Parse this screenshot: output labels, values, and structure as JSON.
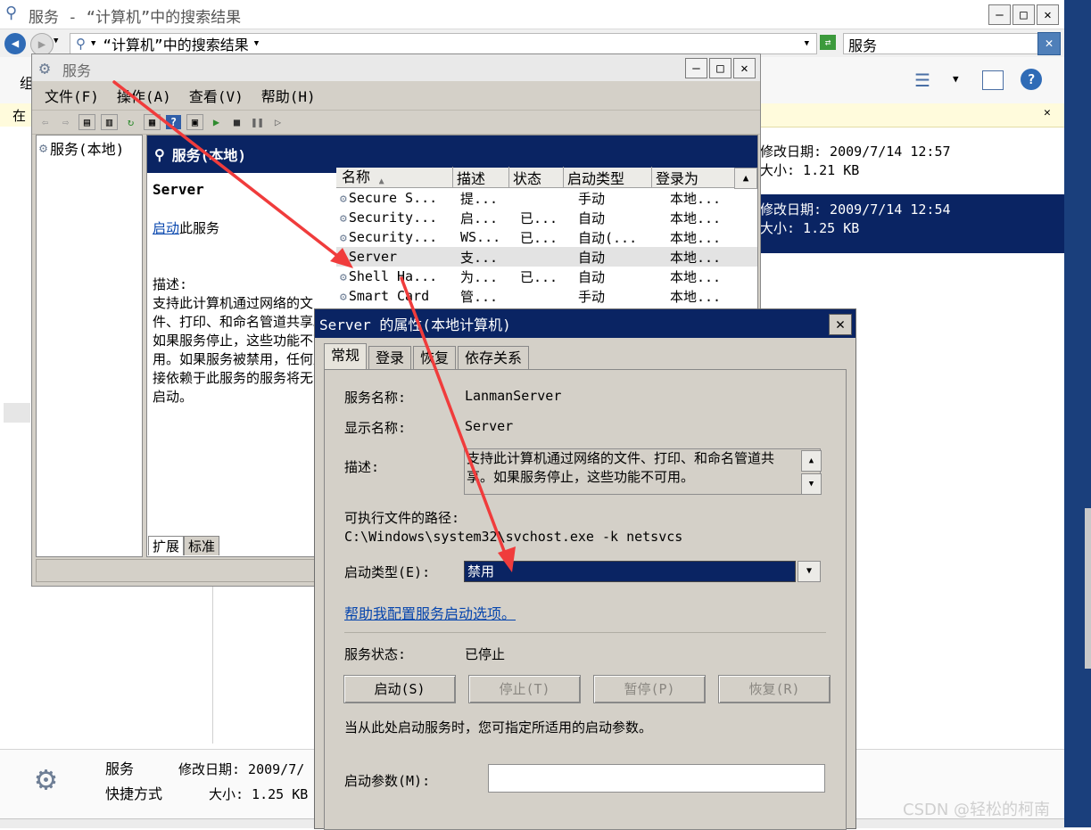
{
  "explorer": {
    "title": "服务 - “计算机”中的搜索结果",
    "address": "“计算机”中的搜索结果",
    "search_value": "服务",
    "toolbar_partial": "组",
    "infobar_partial": "在",
    "file1": {
      "modified": "修改日期: 2009/7/14 12:57",
      "size": "大小: 1.21 KB"
    },
    "file2": {
      "modified": "修改日期: 2009/7/14 12:54",
      "size": "大小: 1.25 KB"
    },
    "details": {
      "name": "服务",
      "type": "快捷方式",
      "modified": "修改日期: 2009/7/",
      "size": "大小: 1.25 KB"
    }
  },
  "services": {
    "title": "服务",
    "menu": [
      "文件(F)",
      "操作(A)",
      "查看(V)",
      "帮助(H)"
    ],
    "tree_item": "服务(本地)",
    "panel_header": "服务(本地)",
    "selected_name": "Server",
    "start_link": "启动",
    "start_suffix": "此服务",
    "desc_label": "描述:",
    "desc_text": "支持此计算机通过网络的文件、打印、和命名管道共享。如果服务停止，这些功能不可用。如果服务被禁用，任何直接依赖于此服务的服务将无法启动。",
    "columns": [
      "名称",
      "描述",
      "状态",
      "启动类型",
      "登录为"
    ],
    "rows": [
      [
        "Secure S...",
        "提...",
        "",
        "手动",
        "本地..."
      ],
      [
        "Security...",
        "启...",
        "已...",
        "自动",
        "本地..."
      ],
      [
        "Security...",
        "WS...",
        "已...",
        "自动(...",
        "本地..."
      ],
      [
        "Server",
        "支...",
        "",
        "自动",
        "本地..."
      ],
      [
        "Shell Ha...",
        "为...",
        "已...",
        "自动",
        "本地..."
      ],
      [
        "Smart Card",
        "管...",
        "",
        "手动",
        "本地..."
      ]
    ],
    "bottom_tabs": [
      "扩展",
      "标准"
    ]
  },
  "dialog": {
    "title": "Server 的属性(本地计算机)",
    "tabs": [
      "常规",
      "登录",
      "恢复",
      "依存关系"
    ],
    "service_name_label": "服务名称:",
    "service_name": "LanmanServer",
    "display_name_label": "显示名称:",
    "display_name": "Server",
    "desc_label": "描述:",
    "desc": "支持此计算机通过网络的文件、打印、和命名管道共享。如果服务停止，这些功能不可用。",
    "path_label": "可执行文件的路径:",
    "path": "C:\\Windows\\system32\\svchost.exe -k netsvcs",
    "start_type_label": "启动类型(E):",
    "start_type": "禁用",
    "help_link": "帮助我配置服务启动选项。",
    "status_label": "服务状态:",
    "status": "已停止",
    "buttons": [
      "启动(S)",
      "停止(T)",
      "暂停(P)",
      "恢复(R)"
    ],
    "hint": "当从此处启动服务时，您可指定所适用的启动参数。",
    "param_label": "启动参数(M):",
    "param_value": ""
  },
  "watermark": "CSDN @轻松的柯南",
  "colors": {
    "selection": "#0a2463",
    "annotation": "#f03c3c",
    "link": "#0645ad"
  }
}
